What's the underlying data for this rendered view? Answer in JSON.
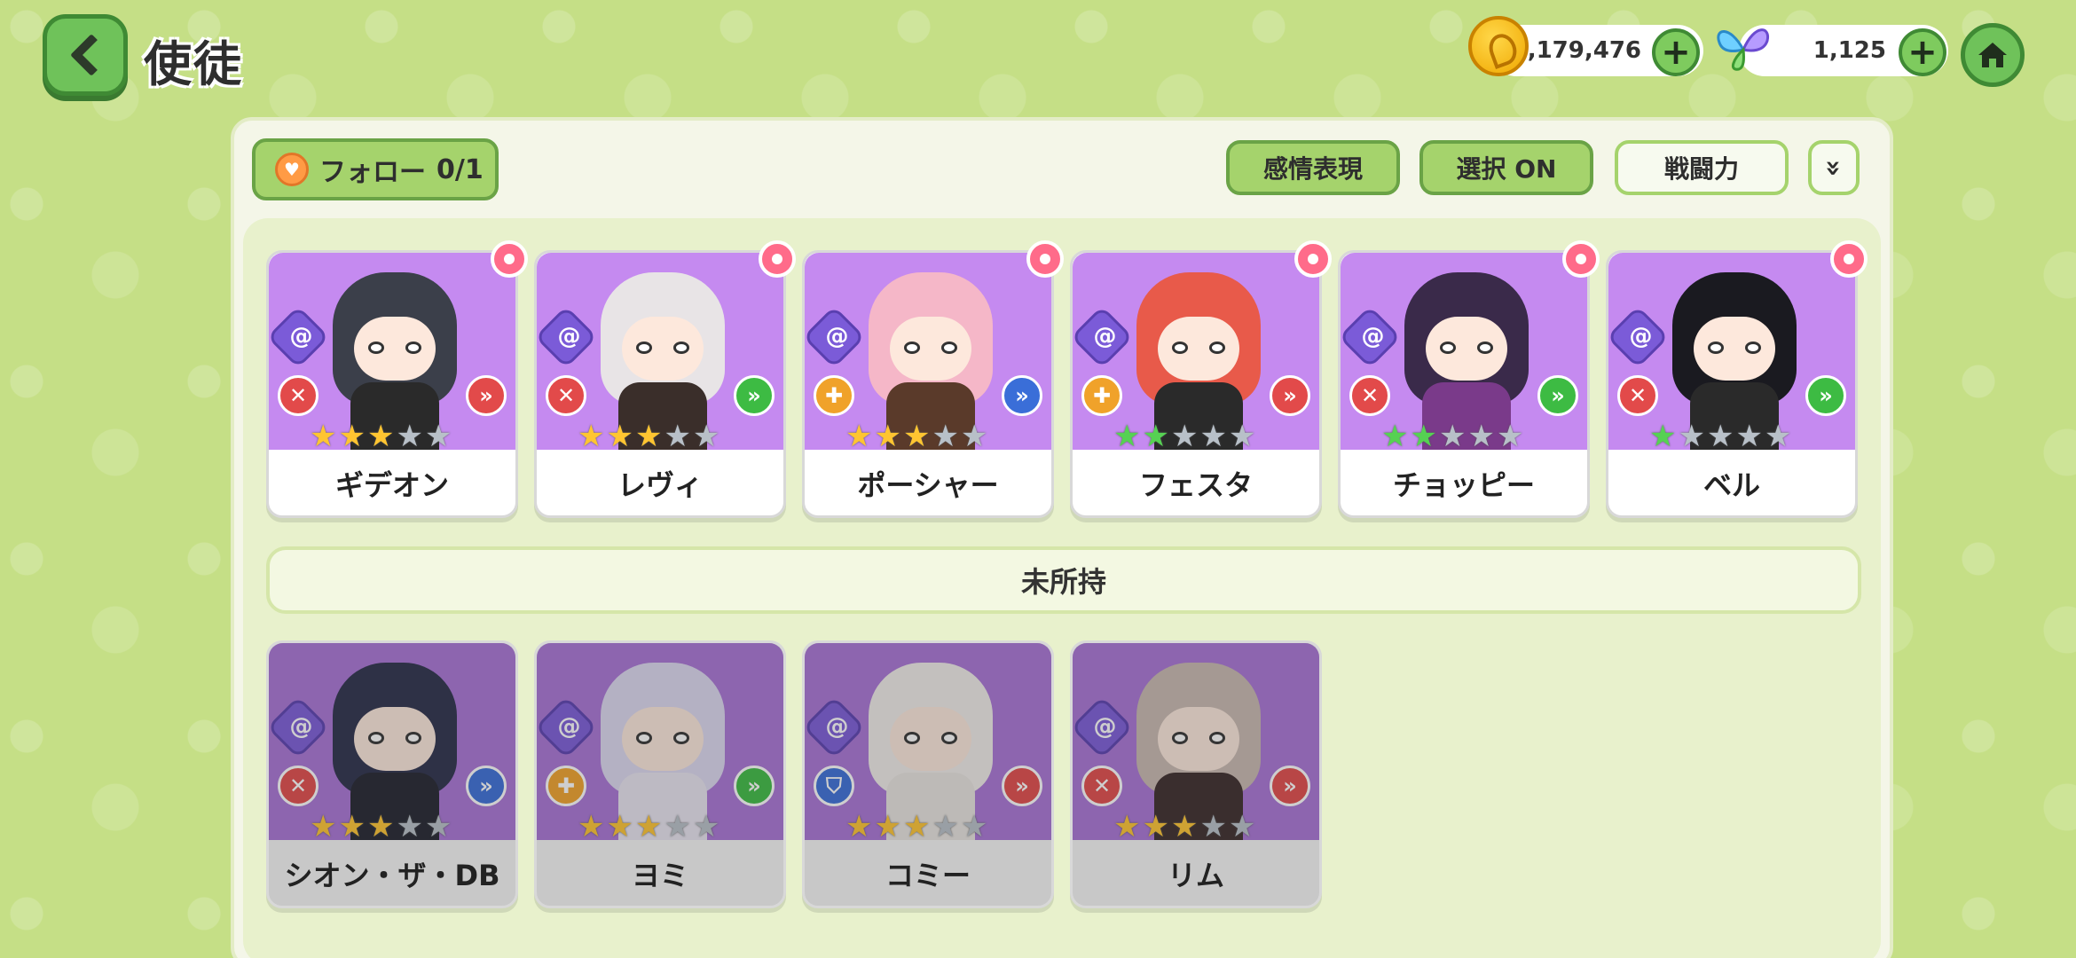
{
  "header": {
    "title": "使徒",
    "gold_amount": "1,179,476",
    "gem_amount": "1,125"
  },
  "toolbar": {
    "follow_label": "フォロー",
    "follow_count": "0/1",
    "emotion_label": "感情表現",
    "select_label": "選択 ON",
    "power_label": "戦闘力",
    "expand_label": "»"
  },
  "owned": [
    {
      "name": "ギデオン",
      "stars": 3,
      "star_color": "gold",
      "role": "red",
      "type": "red",
      "hair": "#3b3f4a",
      "outfit": "#2a2a2a"
    },
    {
      "name": "レヴィ",
      "stars": 3,
      "star_color": "gold",
      "role": "red",
      "type": "green",
      "hair": "#e8e4e6",
      "outfit": "#3a2e2a"
    },
    {
      "name": "ポーシャー",
      "stars": 3,
      "star_color": "gold",
      "role": "orange",
      "type": "blue",
      "hair": "#f5b7c8",
      "outfit": "#5a3a2a"
    },
    {
      "name": "フェスタ",
      "stars": 2,
      "star_color": "green",
      "role": "orange",
      "type": "red",
      "hair": "#e85a4a",
      "outfit": "#2a2a2a"
    },
    {
      "name": "チョッピー",
      "stars": 2,
      "star_color": "green",
      "role": "red",
      "type": "green",
      "hair": "#3a2a4a",
      "outfit": "#7a3a8a"
    },
    {
      "name": "ベル",
      "stars": 1,
      "star_color": "green",
      "role": "red",
      "type": "green",
      "hair": "#1a1a20",
      "outfit": "#2a2a2a"
    }
  ],
  "unowned_section_label": "未所持",
  "unowned": [
    {
      "name": "シオン・ザ・DB",
      "stars": 3,
      "star_color": "gold",
      "role": "red",
      "type": "blue",
      "hair": "#2a2e4a",
      "outfit": "#20222e"
    },
    {
      "name": "ヨミ",
      "stars": 3,
      "star_color": "gold",
      "role": "orange",
      "type": "green",
      "hair": "#ddd8f0",
      "outfit": "#e8e4f0"
    },
    {
      "name": "コミー",
      "stars": 3,
      "star_color": "gold",
      "role": "blue",
      "type": "red",
      "hair": "#f0ecea",
      "outfit": "#e8e4e0"
    },
    {
      "name": "リム",
      "stars": 3,
      "star_color": "gold",
      "role": "red",
      "type": "red",
      "hair": "#c8b8b0",
      "outfit": "#3a2a2a"
    }
  ],
  "icons": {
    "back": "chevron-left-icon",
    "gold": "coin-icon",
    "gem": "butterfly-gem-icon",
    "home": "home-icon",
    "follow": "heart-icon",
    "expand": "double-chevron-down-icon",
    "element": "swirl-element-icon",
    "favorite": "flower-icon"
  }
}
